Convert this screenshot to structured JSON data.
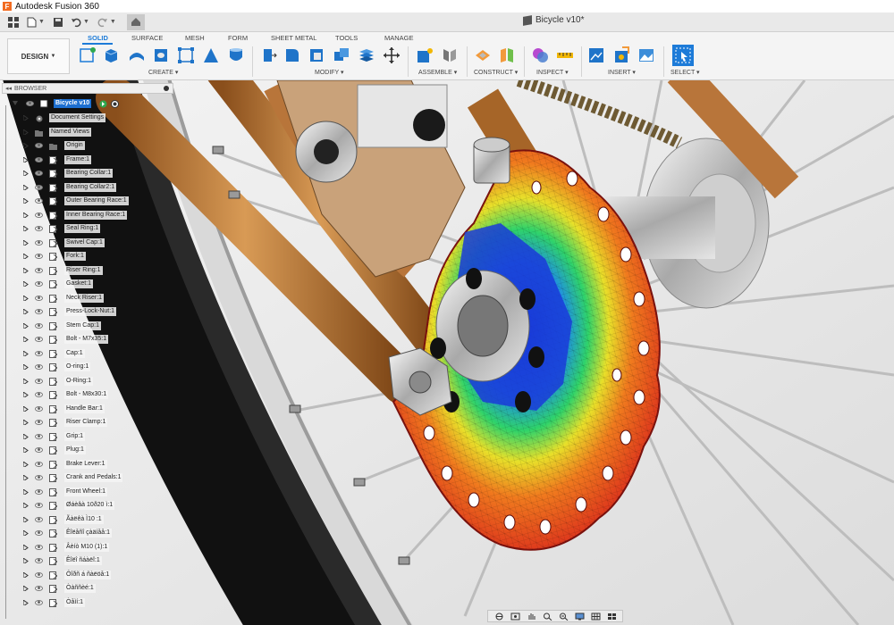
{
  "app": {
    "title": "Autodesk Fusion 360",
    "logo_letter": "F"
  },
  "document": {
    "tab_title": "Bicycle v10*"
  },
  "ribbon": {
    "workspace": "DESIGN",
    "tabs": [
      "SOLID",
      "SURFACE",
      "MESH",
      "FORM",
      "SHEET METAL",
      "TOOLS",
      "MANAGE"
    ],
    "active_tab": "SOLID",
    "groups": [
      "CREATE",
      "MODIFY",
      "ASSEMBLE",
      "CONSTRUCT",
      "INSPECT",
      "INSERT",
      "SELECT"
    ]
  },
  "browser": {
    "title": "BROWSER",
    "root": "Bicycle v10",
    "items": [
      "Document Settings",
      "Named Views",
      "Origin",
      "Frame:1",
      "Bearing Collar:1",
      "Bearing Collar2:1",
      "Outer Bearing Race:1",
      "Inner Bearing Race:1",
      "Seal Ring:1",
      "Swivel Cap:1",
      "Fork:1",
      "Riser Ring:1",
      "Gasket:1",
      "Neck Riser:1",
      "Press-Lock-Nut:1",
      "Stem Cap:1",
      "Bolt - M7x35:1",
      "Cap:1",
      "O-ring:1",
      "O-Ring:1",
      "Bolt - M8x30:1",
      "Handle Bar:1",
      "Riser Clamp:1",
      "Grip:1",
      "Plug:1",
      "Brake Lever:1",
      "Crank and Pedals:1",
      "Front Wheel:1",
      "Øáèâà 10ð20 ì:1",
      "Ãàëêà Ì10 :1",
      "Êîëåñî çàäíåå:1",
      "Âèíò M10  (1):1",
      "Êîëî ñáàëî:1",
      "Ôîðñ á ñàëöå:1",
      "Òàññèé:1",
      "Òåìí:1"
    ]
  },
  "colors": {
    "accent": "#1d7bd8",
    "frame_copper": "#b8753a",
    "rim_dark": "#1c1c1c",
    "viewport_bg": "#e9e9e9"
  },
  "icons": {
    "quick_access": [
      "grid-icon",
      "save-icon",
      "undo-icon",
      "redo-icon",
      "home-icon"
    ],
    "navbar": [
      "orbit-icon",
      "look-at-icon",
      "pan-icon",
      "zoom-icon",
      "fit-icon",
      "display-settings-icon",
      "grid-settings-icon",
      "viewports-icon"
    ]
  }
}
